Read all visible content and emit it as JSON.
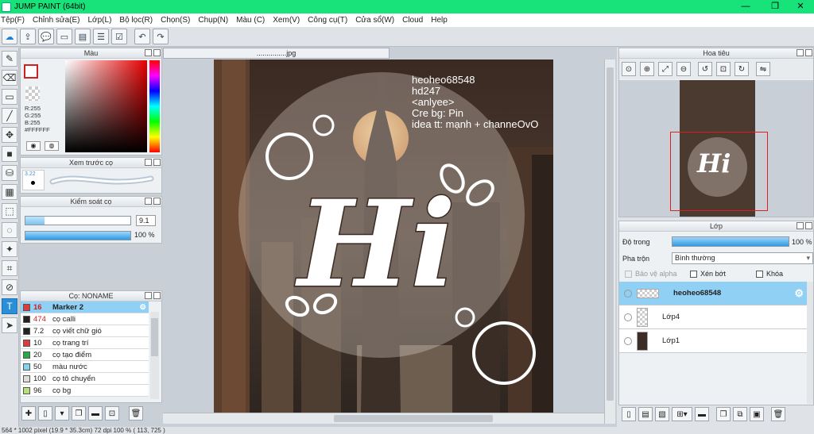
{
  "window": {
    "title": "JUMP PAINT (64bit)",
    "min": "—",
    "max": "❐",
    "close": "✕"
  },
  "menu": [
    "Tệp(F)",
    "Chỉnh sửa(E)",
    "Lớp(L)",
    "Bộ lọc(R)",
    "Chọn(S)",
    "Chụp(N)",
    "Màu (C)",
    "Xem(V)",
    "Công cụ(T)",
    "Cửa sổ(W)",
    "Cloud",
    "Help"
  ],
  "document": {
    "tab_title": "...............jpg"
  },
  "color_panel": {
    "title": "Màu",
    "r": "R:255",
    "g": "G:255",
    "b": "B:255",
    "hex": "#FFFFFF"
  },
  "brush_preview": {
    "title": "Xem trước cọ",
    "size": "3.22"
  },
  "brush_control": {
    "title": "Kiểm soát cọ",
    "size_value": "9.1",
    "opacity_value": "100 %"
  },
  "brush_list": {
    "title": "Cọ: NONAME",
    "items": [
      {
        "size": "16",
        "name": "Marker 2",
        "color": "#e03a3a"
      },
      {
        "size": "474",
        "name": "cọ calli",
        "color": "#222222"
      },
      {
        "size": "7.2",
        "name": "cọ viết chữ gió",
        "color": "#222222"
      },
      {
        "size": "10",
        "name": "cọ trang trí",
        "color": "#e03a3a"
      },
      {
        "size": "20",
        "name": "cọ tạo điểm",
        "color": "#2aa84a"
      },
      {
        "size": "50",
        "name": "màu nước",
        "color": "#7fd4f0"
      },
      {
        "size": "100",
        "name": "cọ tô chuyển",
        "color": "#dddddd"
      },
      {
        "size": "96",
        "name": "cọ bg",
        "color": "#b7e07a"
      }
    ]
  },
  "canvas_text": {
    "lines": [
      "heoheo68548",
      "hd247",
      "<anlyee>",
      "Cre bg: Pin",
      "idea tt: mạnh + channeOvO"
    ],
    "big": "Hi"
  },
  "navigator": {
    "title": "Hoa tiêu"
  },
  "layers": {
    "title": "Lớp",
    "opacity_label": "Độ trong",
    "opacity_value": "100 %",
    "blend_label": "Pha trộn",
    "blend_value": "Bình thường",
    "protect_alpha": "Bảo vệ alpha",
    "clipping": "Xén bớt",
    "lock": "Khóa",
    "items": [
      {
        "name": "heoheo68548",
        "selected": true
      },
      {
        "name": "Lớp4",
        "selected": false
      },
      {
        "name": "Lớp1",
        "selected": false
      }
    ]
  },
  "status": {
    "text": "564 * 1002 pixel  (19.9 * 35.3cm)  72 dpi  100 %  ( 113, 725 )"
  },
  "colors": {
    "accent": "#2a8fd6",
    "titlebar": "#17e37a",
    "selection": "#8fd0f4"
  }
}
